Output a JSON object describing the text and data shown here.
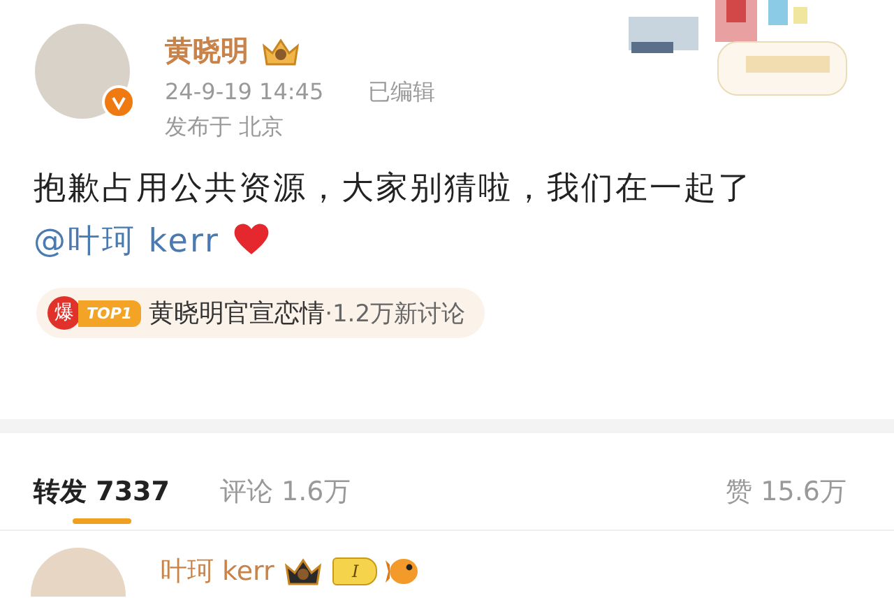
{
  "post": {
    "author": {
      "name": "黄晓明",
      "verified": true
    },
    "timestamp": "24-9-19 14:45",
    "edited_label": "已编辑",
    "location": "发布于 北京",
    "text": "抱歉占用公共资源，大家别猜啦，我们在一起了",
    "mention": "@叶珂 kerr",
    "hot_topic": {
      "badge": "爆",
      "rank": "TOP1",
      "title": "黄晓明官宣恋情",
      "meta": "·1.2万新讨论"
    }
  },
  "tabs": [
    {
      "label": "转发",
      "count": "7337",
      "selected": true
    },
    {
      "label": "评论",
      "count": "1.6万",
      "selected": false
    },
    {
      "label": "赞",
      "count": "15.6万",
      "selected": false
    }
  ],
  "comments": [
    {
      "name": "叶珂 kerr",
      "level": "I"
    }
  ]
}
